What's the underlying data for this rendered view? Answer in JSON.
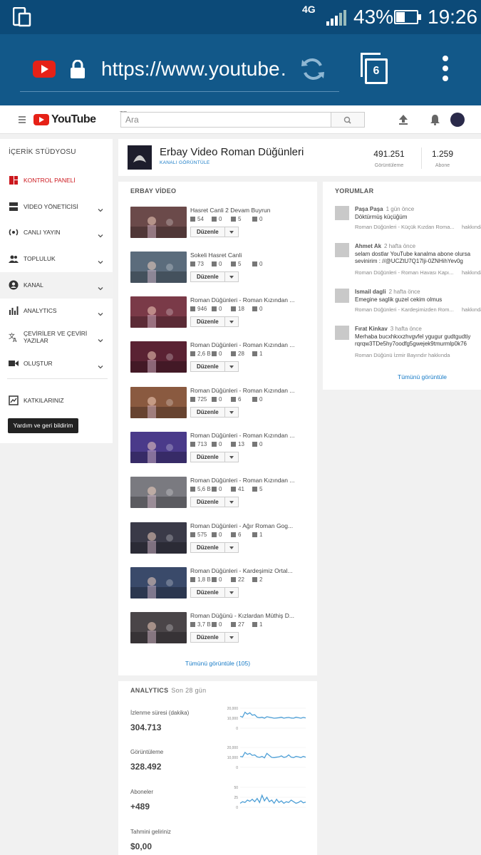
{
  "status_bar": {
    "network": "4G",
    "battery_percent": "43%",
    "battery_level": 0.43,
    "time": "19:26"
  },
  "browser": {
    "url": "https://www.youtube…",
    "tab_count": "6"
  },
  "yt_header": {
    "logo_text": "YouTube",
    "logo_suffix": "TR",
    "search_placeholder": "Ara"
  },
  "sidebar": {
    "title": "İÇERİK STÜDYOSU",
    "items": [
      {
        "label": "KONTROL PANELİ",
        "icon": "dashboard-icon",
        "active": false
      },
      {
        "label": "VİDEO YÖNETİCİSİ",
        "icon": "video-manager-icon",
        "active": false
      },
      {
        "label": "CANLI YAYIN",
        "icon": "live-icon",
        "active": false
      },
      {
        "label": "TOPLULUK",
        "icon": "people-icon",
        "active": false
      },
      {
        "label": "KANAL",
        "icon": "account-icon",
        "active": true
      },
      {
        "label": "ANALYTICS",
        "icon": "analytics-icon",
        "active": false
      },
      {
        "label": "ÇEVİRİLER VE ÇEVİRİ YAZILAR",
        "icon": "translate-icon",
        "active": false
      },
      {
        "label": "OLUŞTUR",
        "icon": "camera-icon",
        "active": false
      },
      {
        "label": "KATKILARINIZ",
        "icon": "contributions-icon",
        "active": false
      }
    ],
    "help_button": "Yardım ve geri bildirim"
  },
  "channel": {
    "name": "Erbay Video Roman Düğünleri",
    "view_channel": "KANALI GÖRÜNTÜLE",
    "views": "491.251",
    "views_label": "Görüntüleme",
    "subscribers": "1.259",
    "subscribers_label": "Abone"
  },
  "videos": {
    "title": "ERBAY VİDEO",
    "edit_label": "Düzenle",
    "see_all": "Tümünü görüntüle (105)",
    "items": [
      {
        "title": "Hasret Canli 2 Devam Buyrun",
        "views": "54",
        "comments": "0",
        "likes": "5",
        "dislikes": "0",
        "thumb": "#6b4a4a"
      },
      {
        "title": "Sokeli Hasret Canli",
        "views": "73",
        "comments": "0",
        "likes": "5",
        "dislikes": "0",
        "thumb": "#5b6c7c"
      },
      {
        "title": "Roman Düğünleri - Roman Kızından ...",
        "views": "946",
        "comments": "0",
        "likes": "18",
        "dislikes": "0",
        "thumb": "#7a3a48"
      },
      {
        "title": "Roman Düğünleri - Roman Kızından ...",
        "views": "2,6 B",
        "comments": "0",
        "likes": "28",
        "dislikes": "1",
        "thumb": "#5a2233"
      },
      {
        "title": "Roman Düğünleri - Roman Kızından ...",
        "views": "725",
        "comments": "0",
        "likes": "6",
        "dislikes": "0",
        "thumb": "#8a5a40"
      },
      {
        "title": "Roman Düğünleri - Roman Kızından ...",
        "views": "713",
        "comments": "0",
        "likes": "13",
        "dislikes": "0",
        "thumb": "#4a3a8a"
      },
      {
        "title": "Roman Düğünleri - Roman Kızından ...",
        "views": "5,6 B",
        "comments": "0",
        "likes": "41",
        "dislikes": "5",
        "thumb": "#7a7a80"
      },
      {
        "title": "Roman Düğünleri - Ağır Roman Gog...",
        "views": "575",
        "comments": "0",
        "likes": "6",
        "dislikes": "1",
        "thumb": "#3a3a48"
      },
      {
        "title": "Roman Düğünleri - Kardeşimiz Ortal...",
        "views": "1,8 B",
        "comments": "0",
        "likes": "22",
        "dislikes": "2",
        "thumb": "#3a4a6a"
      },
      {
        "title": "Roman Düğünü - Kızlardan Müthiş D...",
        "views": "3,7 B",
        "comments": "0",
        "likes": "27",
        "dislikes": "1",
        "thumb": "#4a4548"
      }
    ]
  },
  "comments": {
    "title": "YORUMLAR",
    "see_all": "Tümünü görüntüle",
    "on_label": "hakkında",
    "items": [
      {
        "author": "Paşa Paşa",
        "ago": "1 gün önce",
        "text": "Döktürmüş küçüğüm",
        "video": "Roman Düğünleri - Küçük Kızdan Roma..."
      },
      {
        "author": "Ahmet Ak",
        "ago": "2 hafta önce",
        "text": "selam dostlar YouTube kanalma abone olursa\nsevinirim : //@UCZtU7Q17lji-0ZNHihYev0g",
        "video": "Roman Düğünleri - Roman Havası Kapı..."
      },
      {
        "author": "Ismail dagli",
        "ago": "2 hafta önce",
        "text": "Emegine saglik guzel cekim olmus",
        "video": "Roman Düğünleri - Kardeşimizden Rom..."
      },
      {
        "author": "Fırat Kinkav",
        "ago": "3 hafta önce",
        "text": "Merhaba bucxhkxxzhvgvfel ygugur gudtgudtiy\nrqrqw3TDe5hy7oodfg5gwejek9tmurmlp0k76",
        "video": "Roman Düğünü İzmir Bayındır hakkında"
      }
    ]
  },
  "analytics": {
    "title": "ANALYTICS",
    "period": "Son 28 gün",
    "metrics": [
      {
        "label": "İzlenme süresi (dakika)",
        "value": "304.713",
        "ticks": [
          "20,000",
          "10,000",
          "0"
        ],
        "ymax": 20000,
        "line": [
          12000,
          11000,
          16000,
          14000,
          15500,
          13000,
          13500,
          11000,
          10500,
          11000,
          10000,
          11500,
          11000,
          10500,
          10000,
          10200,
          10500,
          11000,
          10000,
          10500,
          10800,
          10200,
          10000,
          11000,
          10500,
          10000,
          10800,
          10300
        ]
      },
      {
        "label": "Görüntüleme",
        "value": "328.492",
        "ticks": [
          "20,000",
          "10,000",
          "0"
        ],
        "ymax": 20000,
        "line": [
          11000,
          10500,
          15000,
          13000,
          14000,
          12000,
          12500,
          10500,
          10000,
          11000,
          9500,
          14000,
          12000,
          10000,
          9800,
          10200,
          10500,
          11500,
          10000,
          10500,
          12500,
          10200,
          9800,
          11000,
          10500,
          9800,
          11000,
          10200
        ]
      },
      {
        "label": "Aboneler",
        "value": "+489",
        "ticks": [
          "50",
          "25",
          "0"
        ],
        "ymax": 50,
        "line": [
          10,
          14,
          12,
          18,
          15,
          20,
          14,
          22,
          12,
          30,
          16,
          25,
          14,
          18,
          10,
          20,
          12,
          16,
          10,
          14,
          12,
          18,
          14,
          10,
          12,
          16,
          11,
          13
        ]
      },
      {
        "label": "Tahmini geliriniz",
        "value": "$0,00"
      }
    ]
  }
}
